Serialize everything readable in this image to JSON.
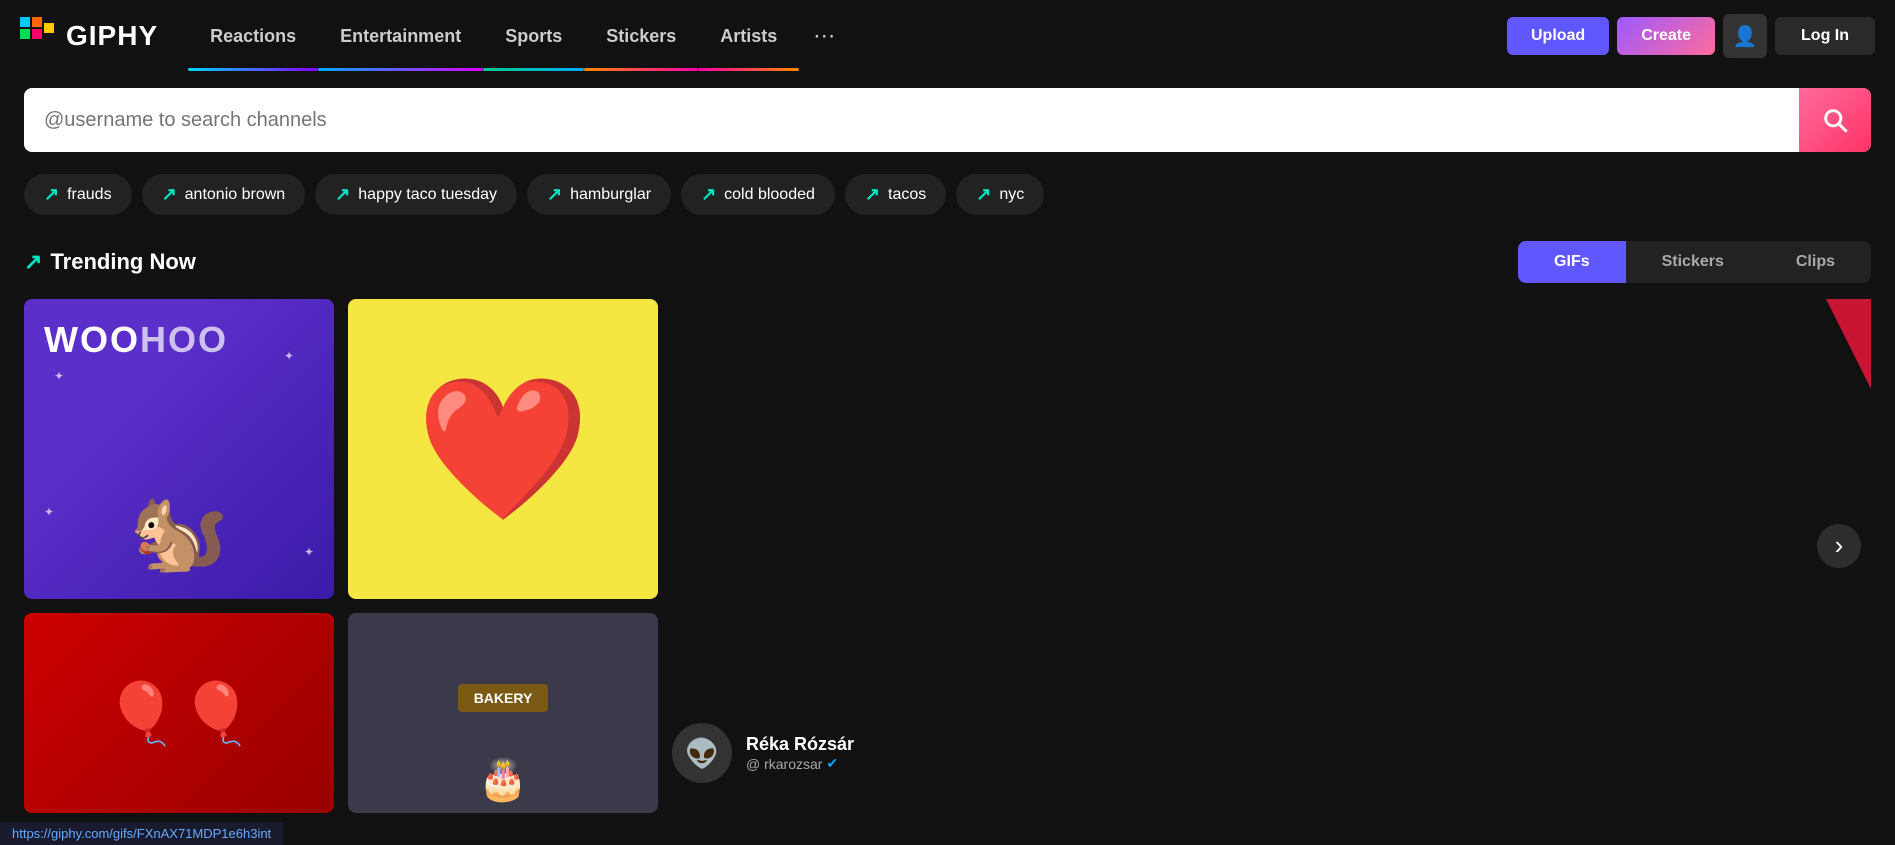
{
  "header": {
    "logo_text": "GIPHY",
    "nav_items": [
      {
        "label": "Reactions",
        "id": "reactions",
        "active": false
      },
      {
        "label": "Entertainment",
        "id": "entertainment",
        "active": false
      },
      {
        "label": "Sports",
        "id": "sports",
        "active": false
      },
      {
        "label": "Stickers",
        "id": "stickers",
        "active": false
      },
      {
        "label": "Artists",
        "id": "artists",
        "active": false
      }
    ],
    "more_label": "•••",
    "upload_label": "Upload",
    "create_label": "Create",
    "login_label": "Log In"
  },
  "search": {
    "placeholder": "@username to search channels"
  },
  "trending_tags": [
    {
      "label": "frauds"
    },
    {
      "label": "antonio brown"
    },
    {
      "label": "happy taco tuesday"
    },
    {
      "label": "hamburglar"
    },
    {
      "label": "cold blooded"
    },
    {
      "label": "tacos"
    },
    {
      "label": "nyc"
    }
  ],
  "trending_now": {
    "title": "Trending Now",
    "tabs": [
      {
        "label": "GIFs",
        "active": true
      },
      {
        "label": "Stickers",
        "active": false
      },
      {
        "label": "Clips",
        "active": false
      }
    ]
  },
  "gifs": [
    {
      "id": "woohoo",
      "type": "woohoo"
    },
    {
      "id": "heart",
      "type": "heart"
    },
    {
      "id": "balloon",
      "type": "balloon"
    },
    {
      "id": "bakery",
      "type": "bakery"
    }
  ],
  "user_card": {
    "name": "Réka Rózsár",
    "handle": "@ rkarozsar",
    "verified": true,
    "avatar_emoji": "👽"
  },
  "status_bar": {
    "url": "https://giphy.com/gifs/FXnAX71MDP1e6h3int"
  },
  "next_arrow": "›"
}
